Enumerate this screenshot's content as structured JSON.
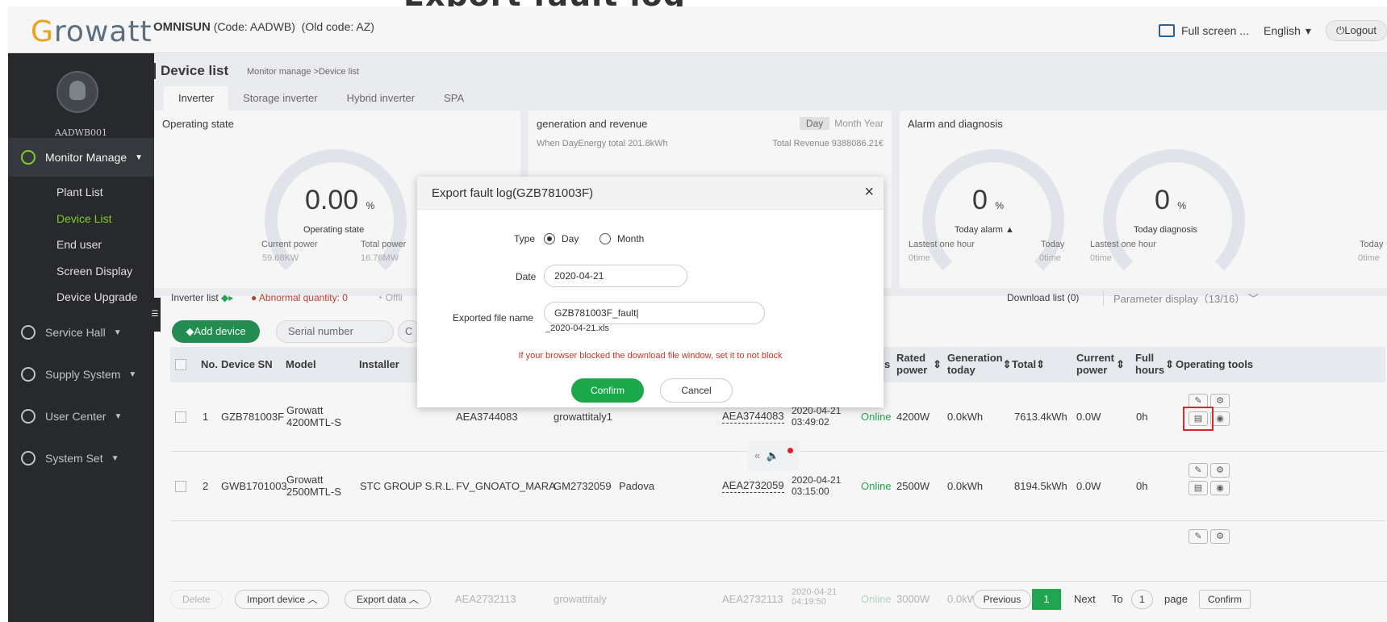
{
  "header": {
    "logo": "Growatt",
    "company_name": "OMNISUN",
    "company_code": "(Code: AADWB)",
    "old_code": "(Old code: AZ)",
    "fullscreen": "Full screen ...",
    "language": "English",
    "logout": "Logout"
  },
  "sidebar": {
    "username": "AADWB001",
    "menus": [
      {
        "label": "Monitor Manage"
      },
      {
        "label": "Service Hall"
      },
      {
        "label": "Supply System"
      },
      {
        "label": "User Center"
      },
      {
        "label": "System Set"
      }
    ],
    "submenu": [
      "Plant List",
      "Device List",
      "End user",
      "Screen Display",
      "Device Upgrade"
    ]
  },
  "page": {
    "title": "Device list",
    "breadcrumb": "Monitor manage >Device list",
    "tabs": [
      "Inverter",
      "Storage inverter",
      "Hybrid inverter",
      "SPA"
    ]
  },
  "operating": {
    "title": "Operating state",
    "value": "0.00",
    "unit": "%",
    "label": "Operating state",
    "current_power_label": "Current power",
    "current_power": "59.68KW",
    "total_power_label": "Total power",
    "total_power": "16.76MW"
  },
  "generation": {
    "title": "generation and revenue",
    "day": "Day",
    "month": "Month",
    "year": "Year",
    "energy": "When DayEnergy total 201.8kWh",
    "revenue": "Total Revenue 9388086.21€"
  },
  "alarm": {
    "title": "Alarm and diagnosis",
    "alarm_value": "0",
    "alarm_unit": "%",
    "alarm_label": "Today alarm",
    "diag_value": "0",
    "diag_unit": "%",
    "diag_label": "Today diagnosis",
    "last_hour": "Lastest one hour",
    "today": "Today",
    "zero": "0time",
    "last_hour2": "Lastest one hour",
    "today2": "Today",
    "zero2": "0time"
  },
  "list": {
    "title": "Inverter list",
    "abnormal": "Abnormal quantity: 0",
    "offline": "Offli",
    "add_device": "Add device",
    "serial_placeholder": "Serial number",
    "filter_c": "C",
    "download": "Download list (0)",
    "param": "Parameter display（13/16）",
    "columns": {
      "no": "No.",
      "sn": "Device SN",
      "model": "Model",
      "installer": "Installer",
      "status_frag": "s",
      "rated": "Rated power",
      "gen_today": "Generation today",
      "total": "Total",
      "current": "Current power",
      "full": "Full hours",
      "tools": "Operating tools"
    },
    "rows": [
      {
        "no": "1",
        "sn": "GZB781003F",
        "model": "Growatt 4200MTL-S",
        "installer": "",
        "datalogger": "AEA3744083",
        "user": "growattitaly1",
        "city": "",
        "dl2": "AEA3744083",
        "time": "2020-04-21 03:49:02",
        "status": "Online",
        "rated": "4200W",
        "gen": "0.0kWh",
        "total": "7613.4kWh",
        "current": "0.0W",
        "full": "0h"
      },
      {
        "no": "2",
        "sn": "GWB1701003",
        "model": "Growatt 2500MTL-S",
        "installer": "STC GROUP S.R.L.",
        "datalogger": "FV_GNOATO_MARA",
        "user": "GM2732059",
        "city": "Padova",
        "dl2": "AEA2732059",
        "time": "2020-04-21 03:15:00",
        "status": "Online",
        "rated": "2500W",
        "gen": "0.0kWh",
        "total": "8194.5kWh",
        "current": "0.0W",
        "full": "0h"
      }
    ],
    "ghost_row": {
      "dl": "AEA2732113",
      "user": "growattitaly",
      "dl2": "AEA2732113",
      "time": "2020-04-21 04:19:50",
      "status": "Online",
      "rated": "3000W",
      "gen": "0.0kW"
    }
  },
  "footer": {
    "delete": "Delete",
    "import": "Import device",
    "export": "Export data",
    "previous": "Previous",
    "page": "1",
    "next": "Next",
    "to": "To",
    "page_input": "1",
    "page_word": "page",
    "confirm": "Confirm"
  },
  "modal": {
    "title": "Export fault log(GZB781003F)",
    "close": "×",
    "type_label": "Type",
    "type_day": "Day",
    "type_month": "Month",
    "date_label": "Date",
    "date_value": "2020-04-21",
    "file_label": "Exported file name",
    "file_value": "GZB781003F_fault",
    "file_suffix": "_2020-04-21.xls",
    "warning": "If your browser blocked the download file window, set it to not block",
    "confirm": "Confirm",
    "cancel": "Cancel"
  },
  "colors": {
    "brand_green": "#1aa84b",
    "sidebar": "#1f2124",
    "active_menu": "#7ed321",
    "warning": "#c0392b",
    "highlight": "#e02020"
  }
}
